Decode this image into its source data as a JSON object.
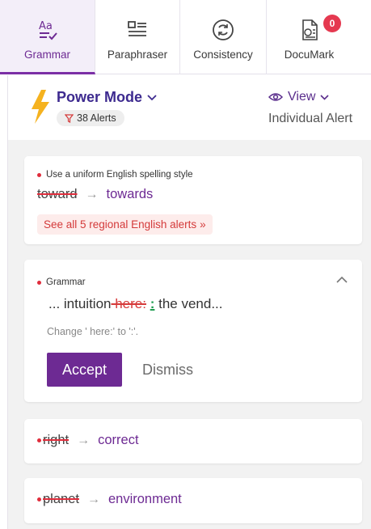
{
  "tabs": [
    {
      "label": "Grammar",
      "icon": "grammar-icon",
      "active": true
    },
    {
      "label": "Paraphraser",
      "icon": "paraphraser-icon"
    },
    {
      "label": "Consistency",
      "icon": "consistency-icon"
    },
    {
      "label": "DocuMark",
      "icon": "documark-icon",
      "badge": "0"
    }
  ],
  "header": {
    "mode_title": "Power Mode",
    "alerts_label": "38 Alerts",
    "view_label": "View",
    "view_sub": "Individual Alert"
  },
  "cards": {
    "regional": {
      "category": "Use a uniform English spelling style",
      "original": "toward",
      "replacement": "towards",
      "see_all": "See all 5 regional English alerts"
    },
    "grammar": {
      "category": "Grammar",
      "excerpt_prefix": "... intuition",
      "excerpt_removed": " here:",
      "excerpt_added": ":",
      "excerpt_suffix": " the vend...",
      "description": "Change ' here:' to ':'.",
      "accept_label": "Accept",
      "dismiss_label": "Dismiss"
    },
    "right": {
      "original": "right",
      "replacement": "correct"
    },
    "planet": {
      "original": "planet",
      "replacement": "environment"
    }
  },
  "colors": {
    "accent": "#6d2a93",
    "title": "#3d2a8f",
    "error": "#e02d3c",
    "badge": "#e53950",
    "bolt": "#f5b21f"
  }
}
